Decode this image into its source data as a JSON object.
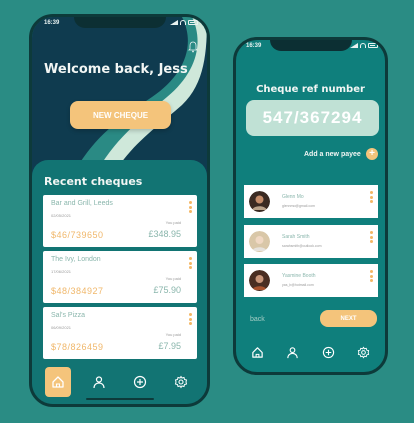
{
  "home_screen": {
    "status_time": "16:39",
    "welcome": "Welcome back, Jess",
    "new_cheque_label": "NEW CHEQUE",
    "recent_title": "Recent cheques",
    "cheques": [
      {
        "name": "Bar and Grill, Leeds",
        "date": "02/05/2021",
        "ref": "$46/739650",
        "amount_label": "You paid",
        "amount": "£348.95"
      },
      {
        "name": "The Ivy, London",
        "date": "17/06/2021",
        "ref": "$48/384927",
        "amount_label": "You paid",
        "amount": "£75.90"
      },
      {
        "name": "Sal's Pizza",
        "date": "06/09/2021",
        "ref": "$78/826459",
        "amount_label": "You paid",
        "amount": "£7.95"
      }
    ],
    "nav": [
      {
        "icon": "home-icon",
        "active": true
      },
      {
        "icon": "user-icon",
        "active": false
      },
      {
        "icon": "plus-circle-icon",
        "active": false
      },
      {
        "icon": "gear-icon",
        "active": false
      }
    ],
    "accent": "#f4c47b"
  },
  "cheque_screen": {
    "status_time": "16:39",
    "ref_title": "Cheque ref number",
    "ref_value": "547/367294",
    "add_payee_label": "Add a new payee",
    "add_payee_symbol": "+",
    "payees": [
      {
        "name": "Glenn Mo",
        "email": "glennmo@gmail.com"
      },
      {
        "name": "Sarah Smith",
        "email": "sarahsmith@outlook.com"
      },
      {
        "name": "Yasmine Booth",
        "email": "yas_b@hotmail.com"
      }
    ],
    "back_label": "back",
    "next_label": "NEXT",
    "nav": [
      {
        "icon": "home-icon"
      },
      {
        "icon": "user-icon"
      },
      {
        "icon": "plus-circle-icon"
      },
      {
        "icon": "gear-icon"
      }
    ]
  }
}
